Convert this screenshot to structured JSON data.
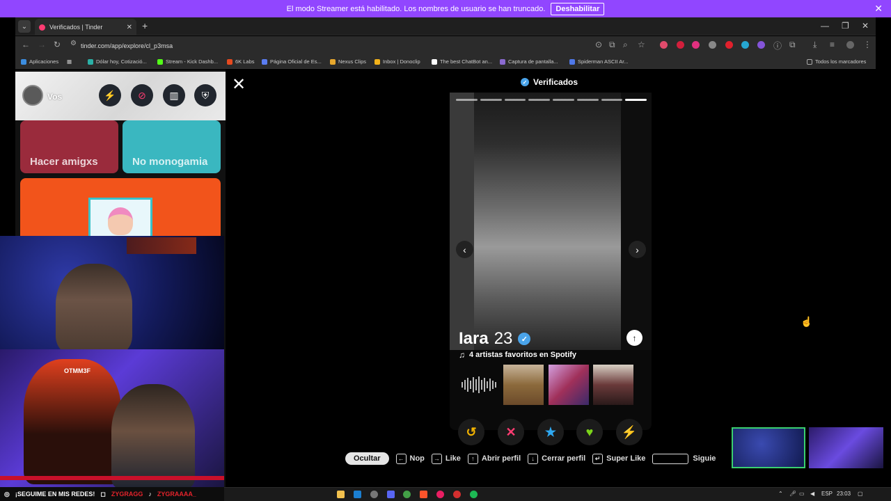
{
  "banner": {
    "message": "El modo Streamer está habilitado. Los nombres de usuario se han truncado.",
    "button": "Deshabilitar"
  },
  "browser": {
    "tab_title": "Verificados | Tinder",
    "url": "tinder.com/app/explore/cl_p3msa",
    "bookmarks": [
      "Aplicaciones",
      "Dólar hoy, Cotizació...",
      "Stream - Kick Dashb...",
      "6K Labs",
      "Página Oficial de Es...",
      "Nexus Clips",
      "Inbox | Donoclip",
      "The best ChatBot an...",
      "Captura de pantalla...",
      "Spiderman ASCII Ar..."
    ],
    "bookmarks_right": "Todos los marcadores"
  },
  "sidebar": {
    "user": "Vos",
    "cards": [
      "Hacer amigxs",
      "No monogamia"
    ]
  },
  "viewer": {
    "title": "Verificados",
    "profile": {
      "name": "Iara",
      "age": "23",
      "spotify": "4 artistas favoritos en Spotify",
      "photo_count": 8,
      "current_photo": 8
    },
    "hints": {
      "hide": "Ocultar",
      "nope": "Nop",
      "like": "Like",
      "open": "Abrir perfil",
      "close": "Cerrar perfil",
      "super": "Super Like",
      "next": "Siguie"
    }
  },
  "stream": {
    "social": "¡SEGUIME EN MIS REDES!",
    "handle1": "ZYGRAGG",
    "handle2": "ZYGRAAAA_",
    "chair_brand": "OTMM3F"
  },
  "taskbar": {
    "lang": "ESP",
    "time": "23:03"
  },
  "colors": {
    "banner": "#9146ff",
    "tinder": "#fe3c72",
    "verified": "#4aa4ea",
    "like": "#7bd41a",
    "superlike": "#2fa9f2",
    "boost": "#a25cff",
    "rewind": "#f4b400"
  }
}
